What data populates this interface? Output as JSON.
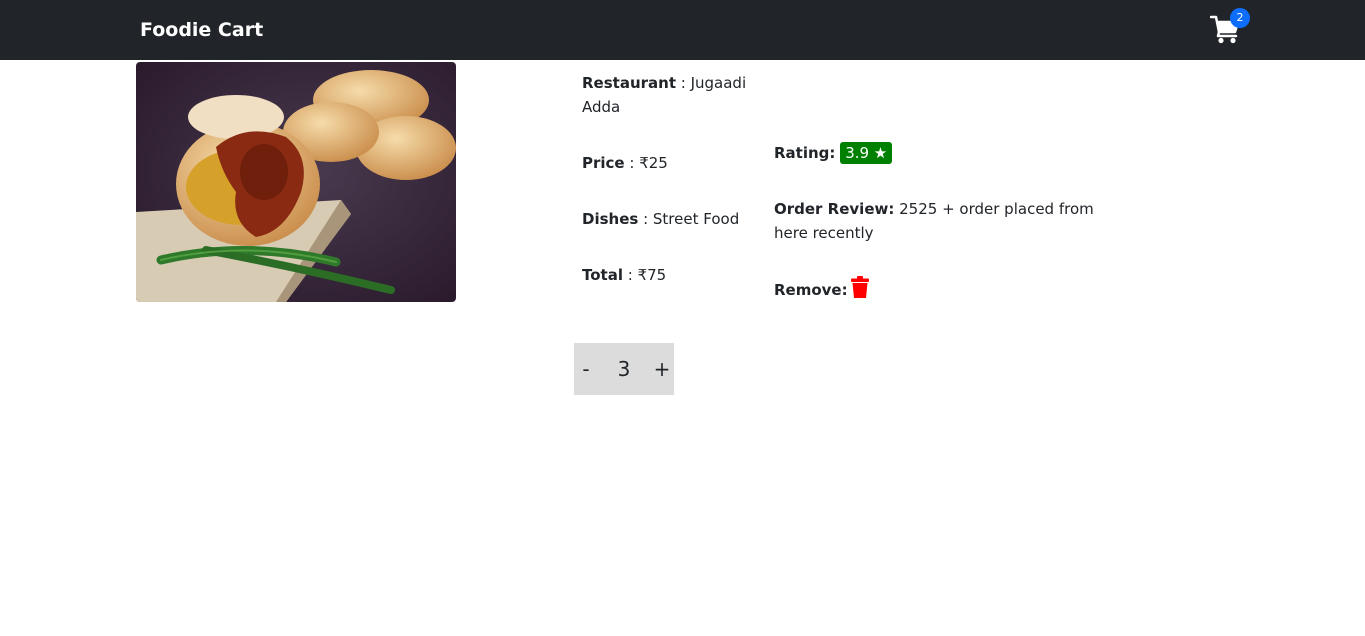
{
  "navbar": {
    "brand": "Foodie Cart",
    "cart_icon": "shopping-cart-icon",
    "cart_count": "2"
  },
  "item": {
    "image_alt": "Vada Pav with green chillies",
    "restaurant_label": "Restaurant",
    "restaurant_sep": " : ",
    "restaurant_value": "Jugaadi Adda",
    "price_label": "Price",
    "price_sep": " : ",
    "price_value": "₹25",
    "dishes_label": "Dishes",
    "dishes_sep": " : ",
    "dishes_value": "Street Food",
    "total_label": "Total",
    "total_sep": " : ",
    "total_value": "₹75",
    "rating_label": "Rating:",
    "rating_value": "3.9 ★",
    "review_label": "Order Review:",
    "review_value": "2525 + order placed from here recently",
    "remove_label": "Remove:",
    "remove_icon": "trash-icon"
  },
  "quantity": {
    "minus": "-",
    "value": "3",
    "plus": "+"
  },
  "colors": {
    "navbar": "#212529",
    "badge": "#0d6efd",
    "rating": "#008000",
    "remove": "#ff0000",
    "quantity_bg": "#dcdcdc"
  }
}
